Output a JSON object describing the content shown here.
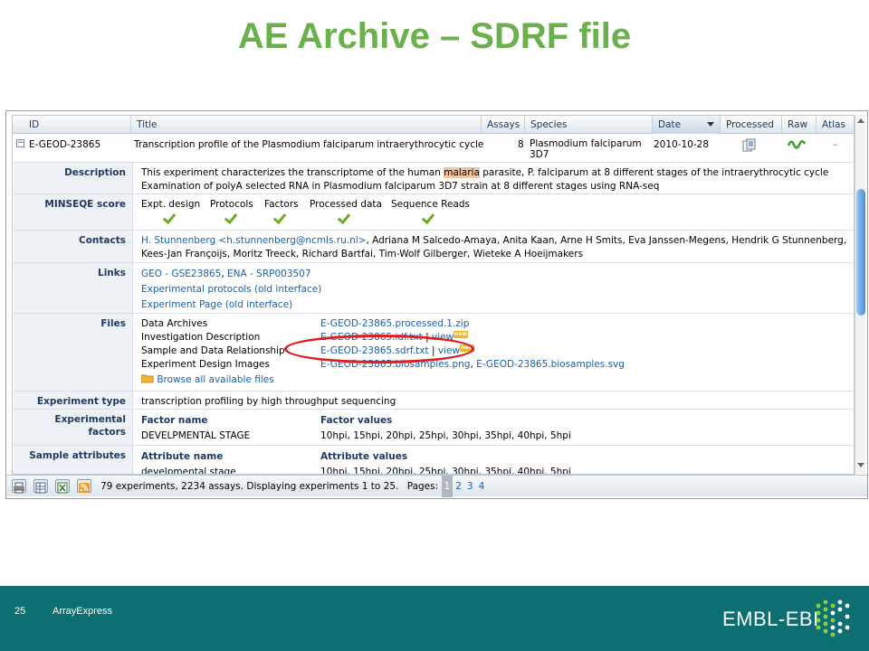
{
  "slide": {
    "title": "AE Archive – SDRF file",
    "number": "25",
    "footer_label": "ArrayExpress",
    "logo_text": "EMBL-EBI"
  },
  "table_header": {
    "id": "ID",
    "title": "Title",
    "assays": "Assays",
    "species": "Species",
    "date": "Date",
    "processed": "Processed",
    "raw": "Raw",
    "atlas": "Atlas"
  },
  "experiment": {
    "toggle": "−",
    "id": "E-GEOD-23865",
    "title": "Transcription profile of the Plasmodium falciparum intraerythrocytic cycle",
    "assays": "8",
    "species_line1": "Plasmodium falciparum",
    "species_line2": "3D7",
    "date": "2010-10-28",
    "atlas": "–"
  },
  "details": {
    "description_label": "Description",
    "description_pre": "This experiment characterizes the transcriptome of the human ",
    "description_hl": "malaria",
    "description_post": " parasite, P. falciparum at 8 different stages of the intraerythrocytic cycle",
    "description_line2": "Examination of polyA selected RNA in Plasmodium falciparum 3D7 strain at 8 different stages using RNA-seq",
    "minseqe_label": "MINSEQE score",
    "minseqe_items": [
      "Expt. design",
      "Protocols",
      "Factors",
      "Processed data",
      "Sequence Reads"
    ],
    "contacts_label": "Contacts",
    "contacts_link": "H. Stunnenberg <h.stunnenberg@ncmls.ru.nl>",
    "contacts_rest": ", Adriana M Salcedo-Amaya, Anita Kaan, Arne H Smits, Eva Janssen-Megens, Hendrik G Stunnenberg,",
    "contacts_line2": "Kees-Jan Françoijs, Moritz Treeck, Richard Bartfai, Tim-Wolf Gilberger, Wieteke A Hoeijmakers",
    "links_label": "Links",
    "link_geo": "GEO - GSE23865",
    "link_sep": ", ",
    "link_ena": "ENA - SRP003507",
    "link_protocols": "Experimental protocols (old interface)",
    "link_page": "Experiment Page (old interface)",
    "files_label": "Files",
    "files": [
      {
        "name": "Data Archives",
        "file": "E-GEOD-23865.processed.1.zip"
      },
      {
        "name": "Investigation Description",
        "file": "E-GEOD-23865.idf.txt",
        "view": "view"
      },
      {
        "name": "Sample and Data Relationship",
        "file": "E-GEOD-23865.sdrf.txt",
        "view": "view"
      },
      {
        "name": "Experiment Design Images",
        "file": "E-GEOD-23865.biosamples.png",
        "file2": "E-GEOD-23865.biosamples.svg"
      }
    ],
    "new_badge": "new",
    "browse_files": "Browse all available files",
    "exp_type_label": "Experiment type",
    "exp_type_value": "transcription profiling by high throughput sequencing",
    "factors_label_1": "Experimental",
    "factors_label_2": "factors",
    "factor_name_hdr": "Factor name",
    "factor_values_hdr": "Factor values",
    "factor_name": "DEVELPMENTAL STAGE",
    "factor_values": "10hpi, 15hpi, 20hpi, 25hpi, 30hpi, 35hpi, 40hpi, 5hpi",
    "sample_label": "Sample attributes",
    "attr_name_hdr": "Attribute name",
    "attr_values_hdr": "Attribute values",
    "attr_name": "develpmental stage",
    "attr_values": "10hpi, 15hpi, 20hpi, 25hpi, 30hpi, 35hpi, 40hpi, 5hpi"
  },
  "footer": {
    "summary": "79 experiments, 2234 assays. Displaying experiments 1 to 25.",
    "pages_label": "Pages:",
    "pages": [
      "1",
      "2",
      "3",
      "4"
    ],
    "current_page": "1"
  },
  "icons": [
    "print-icon",
    "table-export-icon",
    "excel-icon",
    "rss-icon",
    "processed-data-icon",
    "raw-data-icon",
    "folder-icon"
  ],
  "colors": {
    "title": "#6ab04c",
    "band": "#0e6f73",
    "link": "#1a5fb4",
    "check": "#6cab26",
    "highlight_oval": "#e21b1b"
  }
}
